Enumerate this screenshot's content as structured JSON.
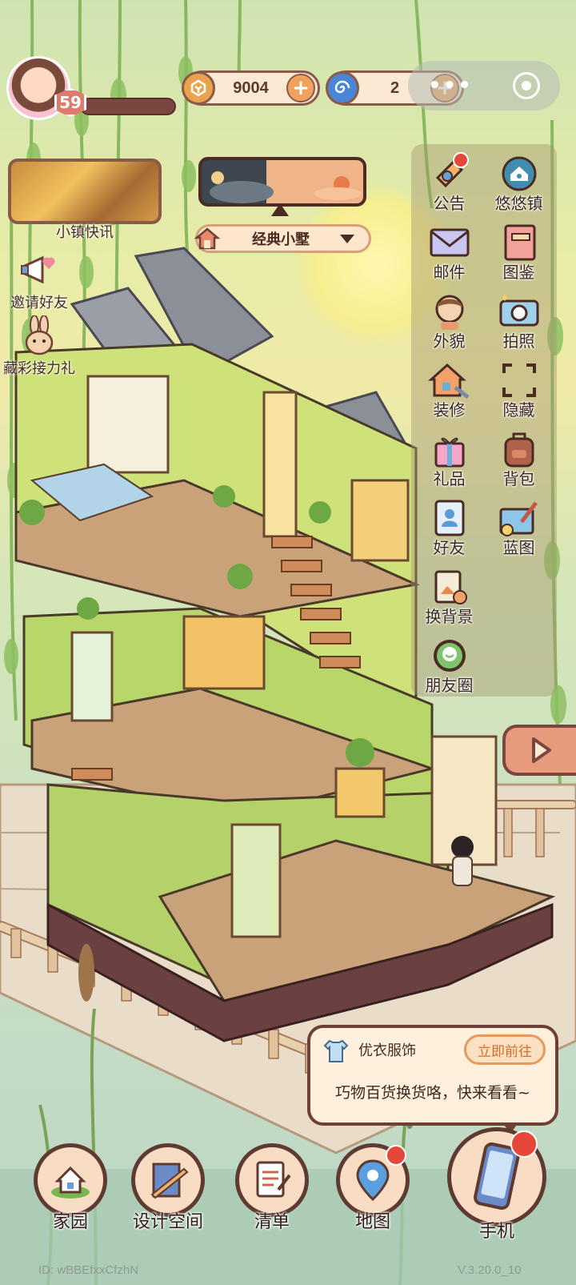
{
  "player": {
    "level": "59"
  },
  "currencies": [
    {
      "name": "coin-icon",
      "value": "9004"
    },
    {
      "name": "swirl-gem-icon",
      "value": "2"
    }
  ],
  "news": {
    "label": "小镇快讯"
  },
  "house": {
    "name": "经典小墅"
  },
  "side_items": [
    {
      "icon": "megaphone-icon",
      "label": "邀请好友"
    },
    {
      "icon": "bunny-icon",
      "label": "藏彩接力礼"
    }
  ],
  "menu": [
    {
      "icon": "bell-icon",
      "label": "公告",
      "badge": true
    },
    {
      "icon": "house-badge-icon",
      "label": "悠悠镇",
      "badge": false
    },
    {
      "icon": "mail-icon",
      "label": "邮件",
      "badge": false
    },
    {
      "icon": "book-icon",
      "label": "图鉴",
      "badge": false
    },
    {
      "icon": "person-icon",
      "label": "外貌",
      "badge": false
    },
    {
      "icon": "camera-icon",
      "label": "拍照",
      "badge": false
    },
    {
      "icon": "house-wrench-icon",
      "label": "装修",
      "badge": false
    },
    {
      "icon": "frame-corners-icon",
      "label": "隐藏",
      "badge": false
    },
    {
      "icon": "gift-icon",
      "label": "礼品",
      "badge": false
    },
    {
      "icon": "backpack-icon",
      "label": "背包",
      "badge": false
    },
    {
      "icon": "contacts-icon",
      "label": "好友",
      "badge": false
    },
    {
      "icon": "blueprint-icon",
      "label": "蓝图",
      "badge": false
    },
    {
      "icon": "image-swap-icon",
      "label": "换背景",
      "badge": false
    },
    {
      "icon": "moments-icon",
      "label": "朋友圈",
      "badge": false
    }
  ],
  "notification": {
    "shop": "优衣服饰",
    "action": "立即前往",
    "message": "巧物百货换货咯，快来看看~"
  },
  "bottom_nav": [
    {
      "icon": "home-garden-icon",
      "label": "家园",
      "badge": false
    },
    {
      "icon": "ruler-design-icon",
      "label": "设计空间",
      "badge": false
    },
    {
      "icon": "checklist-icon",
      "label": "清单",
      "badge": false
    },
    {
      "icon": "map-pin-icon",
      "label": "地图",
      "badge": true
    },
    {
      "icon": "phone-icon",
      "label": "手机",
      "badge": true
    }
  ],
  "footer": {
    "id": "ID: wBBEfxxCfzhN",
    "version": "V.3.20.0_10"
  },
  "colors": {
    "accent": "#f1a15e",
    "frame": "#5e3a30",
    "badge": "#e5483a"
  }
}
